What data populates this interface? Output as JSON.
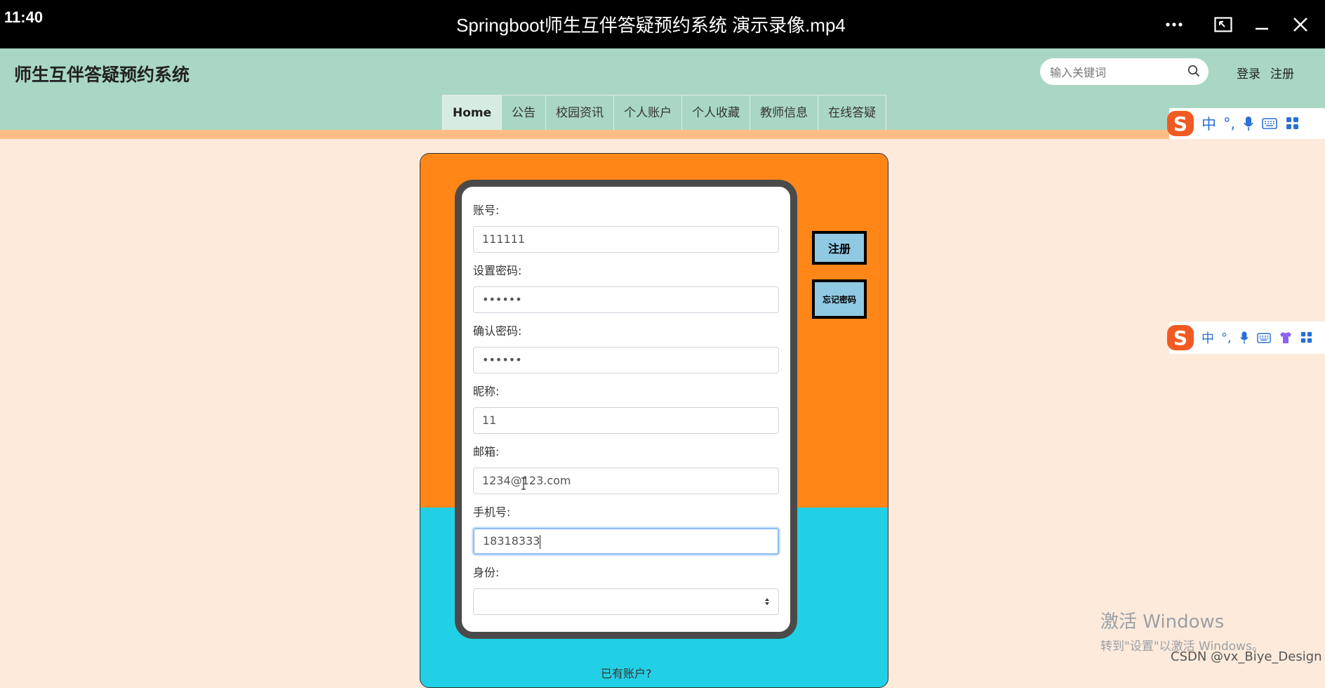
{
  "window": {
    "clock": "11:40",
    "title": "Springboot师生互伴答疑预约系统 演示录像.mp4"
  },
  "site": {
    "title": "师生互伴答疑预约系统",
    "search_placeholder": "输入关键词",
    "login": "登录",
    "register": "注册"
  },
  "nav": {
    "items": [
      "Home",
      "公告",
      "校园资讯",
      "个人账户",
      "个人收藏",
      "教师信息",
      "在线答疑"
    ],
    "active": "Home"
  },
  "ime": {
    "zh": "中",
    "punct": "°,"
  },
  "form": {
    "account": {
      "label": "账号:",
      "value": "111111"
    },
    "password": {
      "label": "设置密码:",
      "value": "••••••"
    },
    "confirm": {
      "label": "确认密码:",
      "value": "••••••"
    },
    "nickname": {
      "label": "昵称:",
      "value": "11"
    },
    "email": {
      "label": "邮箱:",
      "value": "1234@123.com"
    },
    "phone": {
      "label": "手机号:",
      "value": "18318333"
    },
    "identity": {
      "label": "身份:",
      "value": ""
    }
  },
  "side_buttons": {
    "register": "注册",
    "forgot": "忘记密码"
  },
  "bottom_text": "已有账户?",
  "watermark": {
    "line1": "激活 Windows",
    "line2": "转到\"设置\"以激活 Windows。"
  },
  "csdn": "CSDN @vx_Biye_Design",
  "colors": {
    "header": "#a9d7c4",
    "page_bg": "#fdeadb",
    "card_orange": "#ff8617",
    "card_cyan": "#22d0e6",
    "side_button": "#8fc9e3"
  }
}
